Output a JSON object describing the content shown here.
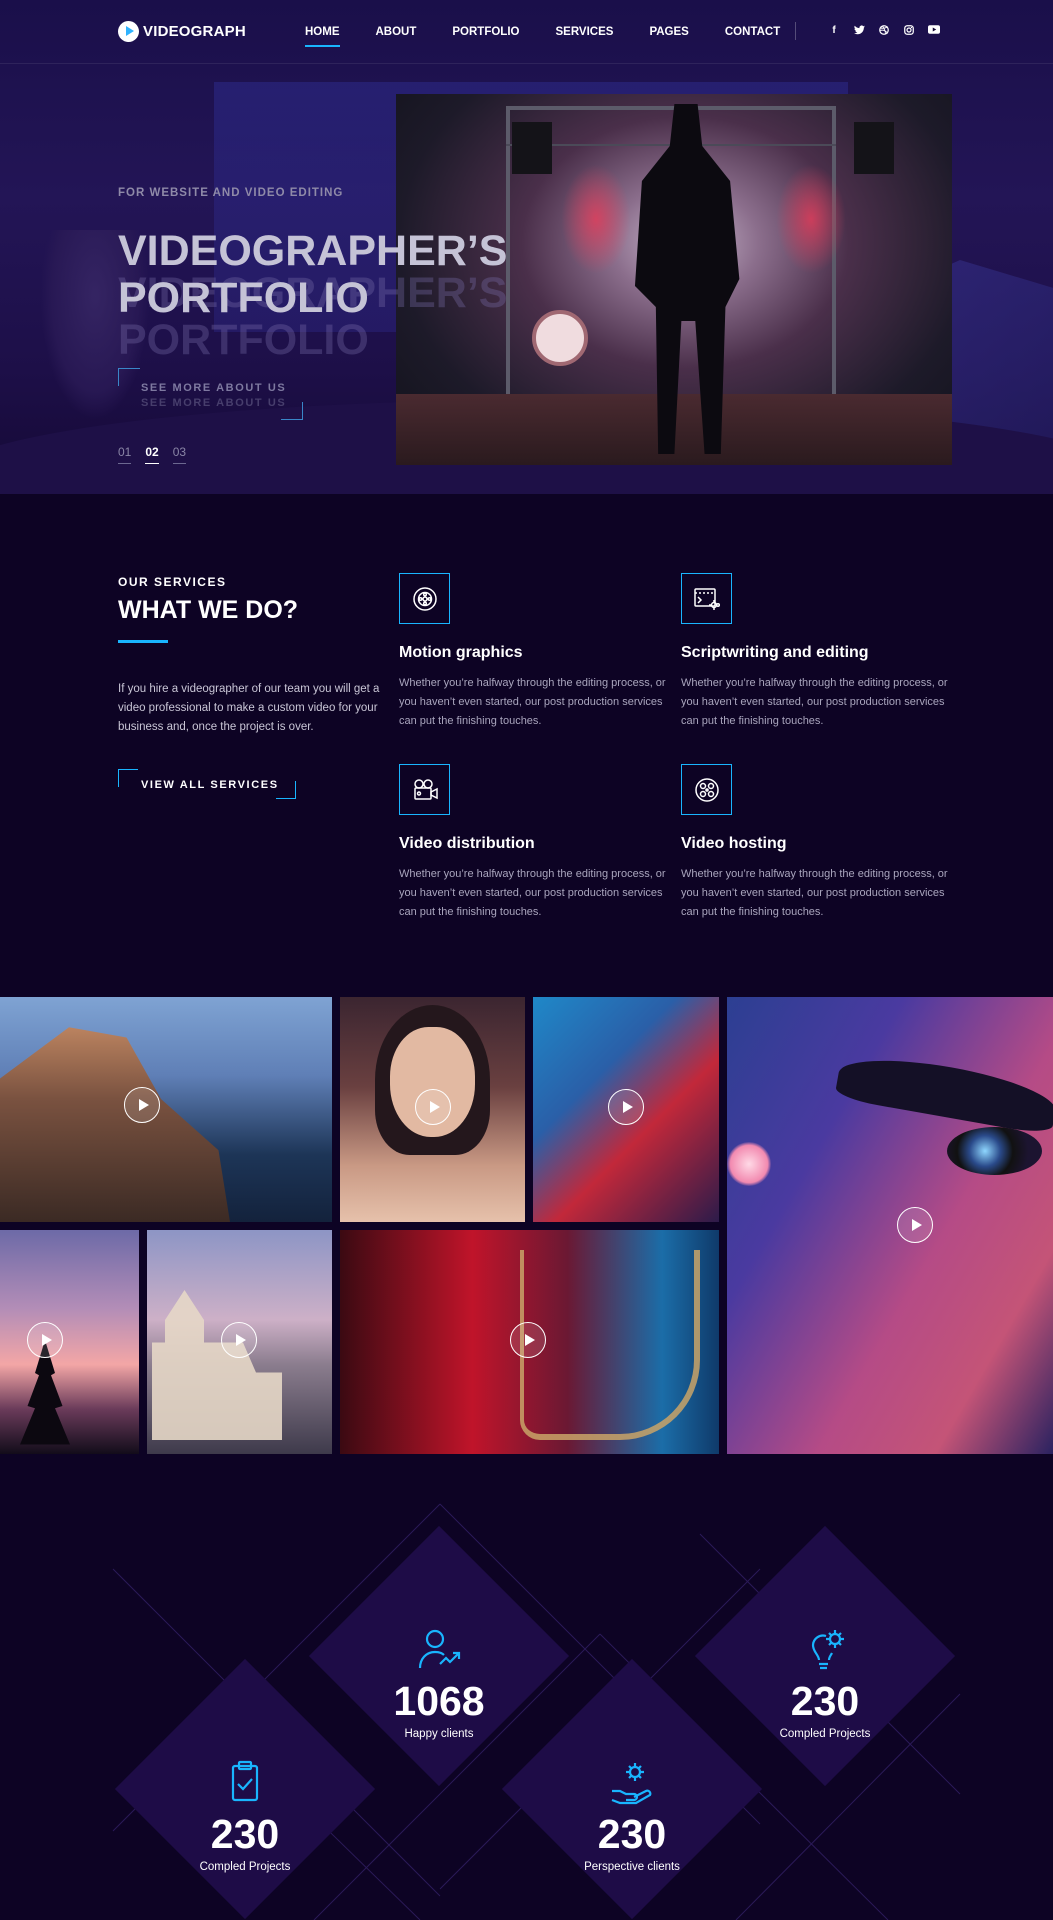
{
  "header": {
    "logo": "VIDEOGRAPH",
    "nav": [
      "HOME",
      "ABOUT",
      "PORTFOLIO",
      "SERVICES",
      "PAGES",
      "CONTACT"
    ],
    "active_nav": "HOME",
    "social": [
      "f",
      "t",
      "d",
      "ig",
      "yt"
    ]
  },
  "hero": {
    "kicker": "FOR WEBSITE AND VIDEO EDITING",
    "title": "VIDEOGRAPHER’S PORTFOLIO",
    "button": "SEE MORE ABOUT US",
    "slides": [
      "01",
      "02",
      "03"
    ],
    "active_slide": "02"
  },
  "services": {
    "kicker": "OUR SERVICES",
    "title": "WHAT WE DO?",
    "description": "If you hire a videographer of our team you will get a video professional to make a custom video for your business and, once the project is over.",
    "button": "VIEW ALL SERVICES",
    "items": [
      {
        "title": "Motion graphics",
        "text": "Whether you’re halfway through the editing process, or you haven’t even started, our post production services can put the finishing touches.",
        "icon": "film-reel-icon"
      },
      {
        "title": "Scriptwriting and editing",
        "text": "Whether you’re halfway through the editing process, or you haven’t even started, our post production services can put the finishing touches.",
        "icon": "script-edit-icon"
      },
      {
        "title": "Video distribution",
        "text": "Whether you’re halfway through the editing process, or you haven’t even started, our post production services can put the finishing touches.",
        "icon": "video-camera-icon"
      },
      {
        "title": "Video hosting",
        "text": "Whether you’re halfway through the editing process, or you haven’t even started, our post production services can put the finishing touches.",
        "icon": "film-hosting-icon"
      }
    ]
  },
  "gallery": {
    "items": [
      "coastal-village",
      "woman-portrait",
      "neon-portrait",
      "closeup-face",
      "sunset-tree",
      "lakeside-castle",
      "saxophone-player"
    ]
  },
  "stats": [
    {
      "value": "1068",
      "label": "Happy clients",
      "icon": "user-growth-icon"
    },
    {
      "value": "230",
      "label": "Compled Projects",
      "icon": "bulb-gear-icon"
    },
    {
      "value": "230",
      "label": "Compled Projects",
      "icon": "clipboard-check-icon"
    },
    {
      "value": "230",
      "label": "Perspective clients",
      "icon": "hand-gear-icon"
    }
  ],
  "colors": {
    "accent": "#19b5fe",
    "background": "#0d0324",
    "diamond": "#1e0c47"
  }
}
